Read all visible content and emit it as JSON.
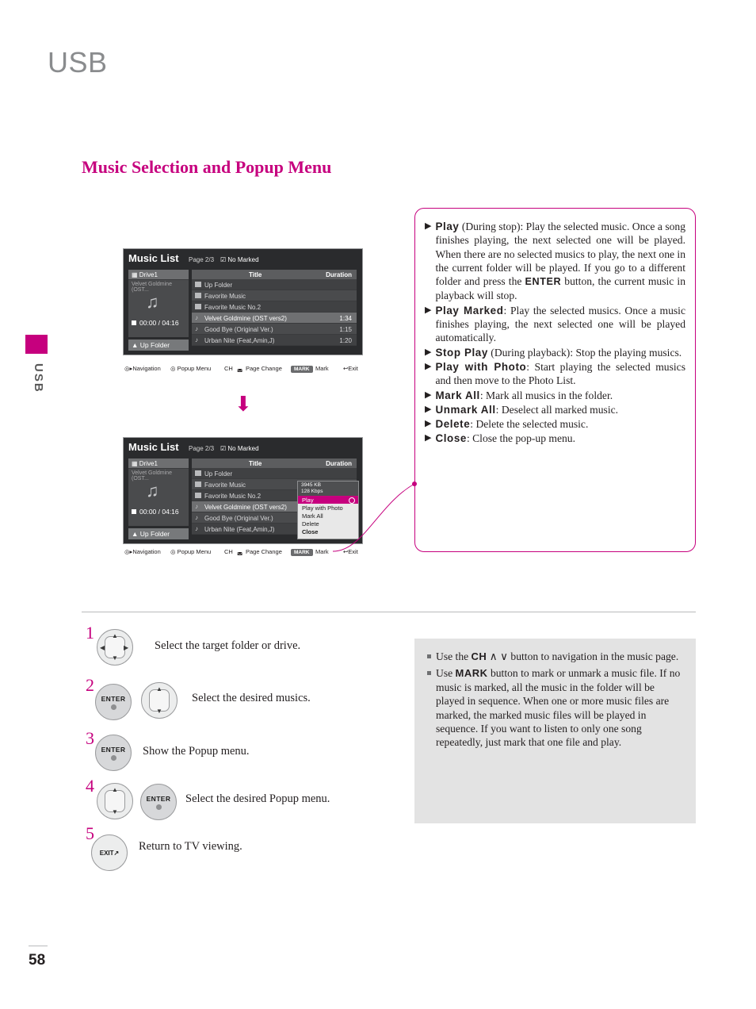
{
  "header": {
    "title": "USB",
    "side_label": "USB",
    "page_number": "58"
  },
  "section": {
    "title": "Music Selection and Popup Menu"
  },
  "callout": {
    "items": [
      {
        "keyword": "Play",
        "rest": " (During stop): Play the selected music. Once a song finishes playing, the next selected one will be played. When there are no selected musics to play, the next one in the current folder will be played. If you go to a different folder and press the ",
        "inline_kw": "ENTER",
        "tail": " button, the current music in playback will stop."
      },
      {
        "keyword": "Play Marked",
        "rest": ": Play the selected musics. Once a music finishes playing, the next selected one will be played automatically.",
        "inline_kw": "",
        "tail": ""
      },
      {
        "keyword": "Stop Play",
        "rest": " (During playback): Stop the playing musics.",
        "inline_kw": "",
        "tail": ""
      },
      {
        "keyword": "Play with Photo",
        "rest": ": Start playing the selected musics and then move to the Photo List.",
        "inline_kw": "",
        "tail": ""
      },
      {
        "keyword": "Mark All",
        "rest": ": Mark all musics in the folder.",
        "inline_kw": "",
        "tail": ""
      },
      {
        "keyword": "Unmark All",
        "rest": ": Deselect all marked music.",
        "inline_kw": "",
        "tail": ""
      },
      {
        "keyword": "Delete",
        "rest": ": Delete the selected music.",
        "inline_kw": "",
        "tail": ""
      },
      {
        "keyword": "Close",
        "rest": ": Close the pop-up menu.",
        "inline_kw": "",
        "tail": ""
      }
    ]
  },
  "tv_screen": {
    "title": "Music List",
    "page_indicator": "Page 2/3",
    "marked_label": "No Marked",
    "drive": {
      "name": "Drive1",
      "subtitle": "Velvet Goldmine (OST..."
    },
    "time": "00:00 / 04:16",
    "up_folder_button": "Up Folder",
    "columns": {
      "title": "Title",
      "duration": "Duration"
    },
    "rows": [
      {
        "name": "Up Folder",
        "duration": "",
        "icon": "folder-up"
      },
      {
        "name": "Favorite Music",
        "duration": "",
        "icon": "folder"
      },
      {
        "name": "Favorite Music No.2",
        "duration": "",
        "icon": "folder"
      },
      {
        "name": "Velvet Goldmine (OST vers2)",
        "duration": "1:34",
        "icon": "note"
      },
      {
        "name": "Good Bye (Original Ver.)",
        "duration": "1:15",
        "icon": "note"
      },
      {
        "name": "Urban Nite (Feat,Amin,J)",
        "duration": "1:20",
        "icon": "note"
      }
    ],
    "footer": {
      "navigation": "Navigation",
      "popup_menu": "Popup Menu",
      "ch": "CH",
      "page_change": "Page Change",
      "mark_chip": "MARK",
      "mark": "Mark",
      "exit": "Exit"
    }
  },
  "popup_menu": {
    "file_size": "3945 KB",
    "bitrate": "128 Kbps",
    "items": [
      {
        "label": "Play",
        "highlight": true
      },
      {
        "label": "Play with Photo",
        "highlight": false
      },
      {
        "label": "Mark All",
        "highlight": false
      },
      {
        "label": "Delete",
        "highlight": false
      },
      {
        "label": "Close",
        "highlight": false
      }
    ]
  },
  "steps": [
    {
      "num": "1",
      "text": "Select the target folder or drive.",
      "buttons": [
        "nav"
      ]
    },
    {
      "num": "2",
      "text": "Select the desired musics.",
      "buttons": [
        "enter",
        "nav"
      ]
    },
    {
      "num": "3",
      "text": "Show the Popup menu.",
      "buttons": [
        "enter"
      ]
    },
    {
      "num": "4",
      "text": "Select the desired Popup menu.",
      "buttons": [
        "nav",
        "enter"
      ]
    },
    {
      "num": "5",
      "text": "Return to TV viewing.",
      "buttons": [
        "exit"
      ]
    }
  ],
  "button_labels": {
    "enter": "ENTER",
    "exit": "EXIT"
  },
  "notes": [
    {
      "pre": "Use the ",
      "kw": "CH",
      "mid": "  ∧ ∨  button to navigation in the music page.",
      "post": ""
    },
    {
      "pre": "Use ",
      "kw": "MARK",
      "mid": " button to mark or unmark a music file. If no music is marked, all the music in the folder will be played in sequence. When one or more music files are marked, the marked music files will be played in sequence. If you want to listen to only one song repeatedly, just mark that one file and play.",
      "post": ""
    }
  ],
  "colors": {
    "accent": "#c6007e",
    "header_gray": "#8a8c8e",
    "note_bg": "#e3e3e3"
  }
}
